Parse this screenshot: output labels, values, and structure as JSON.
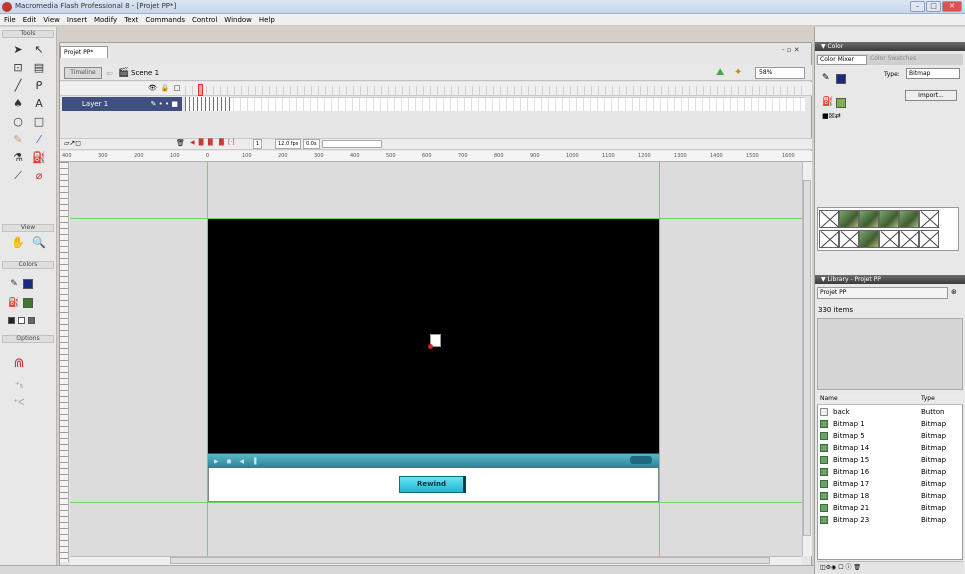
{
  "window": {
    "title": "Macromedia Flash Professional 8 - [Projet PP*]",
    "controls": [
      "–",
      "□",
      "✕"
    ]
  },
  "menu": [
    "File",
    "Edit",
    "View",
    "Insert",
    "Modify",
    "Text",
    "Commands",
    "Control",
    "Window",
    "Help"
  ],
  "toolbar": {
    "tools_label": "Tools",
    "view_label": "View",
    "colors_label": "Colors",
    "options_label": "Options"
  },
  "document": {
    "tab": "Projet PP*",
    "window_controls": "- ▫ ✕",
    "timeline_button": "Timeline",
    "scene": "Scene 1",
    "zoom": "58%",
    "layer_name": "Layer 1",
    "frame_number": "1",
    "fps": "12.0 fps",
    "time": "0.0s",
    "ruler_ticks": [
      "400",
      "300",
      "200",
      "100",
      "0",
      "100",
      "200",
      "300",
      "400",
      "500",
      "600",
      "700",
      "800",
      "900",
      "1000",
      "1100",
      "1200",
      "1300",
      "1400",
      "1500",
      "1600"
    ],
    "rewind_label": "Rewind"
  },
  "color_panel": {
    "title": "▼ Color",
    "tab_mixer": "Color Mixer",
    "tab_swatches": "Color Swatches",
    "type_label": "Type:",
    "type_value": "Bitmap",
    "import_label": "Import..."
  },
  "library": {
    "title": "▼ Library - Projet PP",
    "selector": "Projet PP",
    "count": "330 items",
    "col_name": "Name",
    "col_type": "Type",
    "items": [
      {
        "name": "back",
        "type": "Button"
      },
      {
        "name": "Bitmap 1",
        "type": "Bitmap"
      },
      {
        "name": "Bitmap 5",
        "type": "Bitmap"
      },
      {
        "name": "Bitmap 14",
        "type": "Bitmap"
      },
      {
        "name": "Bitmap 15",
        "type": "Bitmap"
      },
      {
        "name": "Bitmap 16",
        "type": "Bitmap"
      },
      {
        "name": "Bitmap 17",
        "type": "Bitmap"
      },
      {
        "name": "Bitmap 18",
        "type": "Bitmap"
      },
      {
        "name": "Bitmap 21",
        "type": "Bitmap"
      },
      {
        "name": "Bitmap 23",
        "type": "Bitmap"
      }
    ]
  },
  "colors": {
    "video_bg": "#000000",
    "controlbar": "#2c7f92",
    "button": "#1fb7d1",
    "guide": "#6fd16f",
    "layer_active": "#3f4f7f"
  }
}
